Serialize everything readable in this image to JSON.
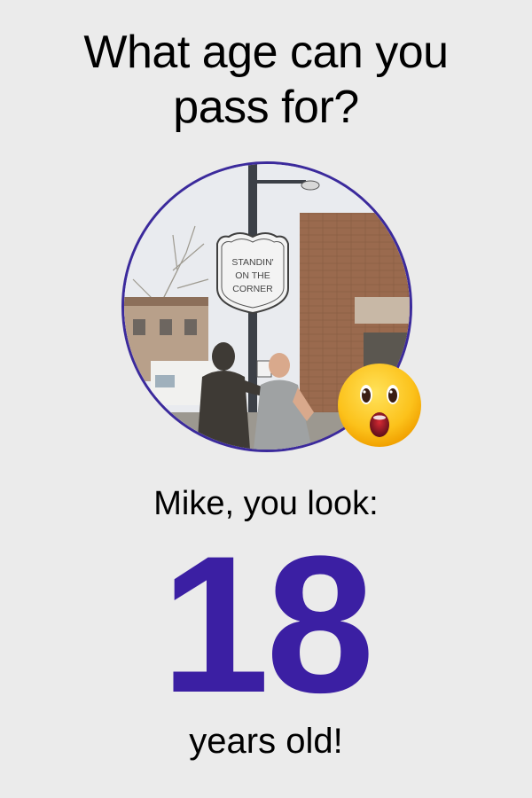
{
  "header": {
    "title_line1": "What age can you",
    "title_line2": "pass for?"
  },
  "photo": {
    "sign_line1": "STANDIN'",
    "sign_line2": "ON THE",
    "sign_line3": "CORNER",
    "border_color": "#3b2a9c"
  },
  "reaction": {
    "icon": "astonished-face-emoji"
  },
  "result": {
    "intro": "Mike, you look:",
    "age": "18",
    "suffix": "years old!",
    "accent_color": "#3b1fa3"
  }
}
